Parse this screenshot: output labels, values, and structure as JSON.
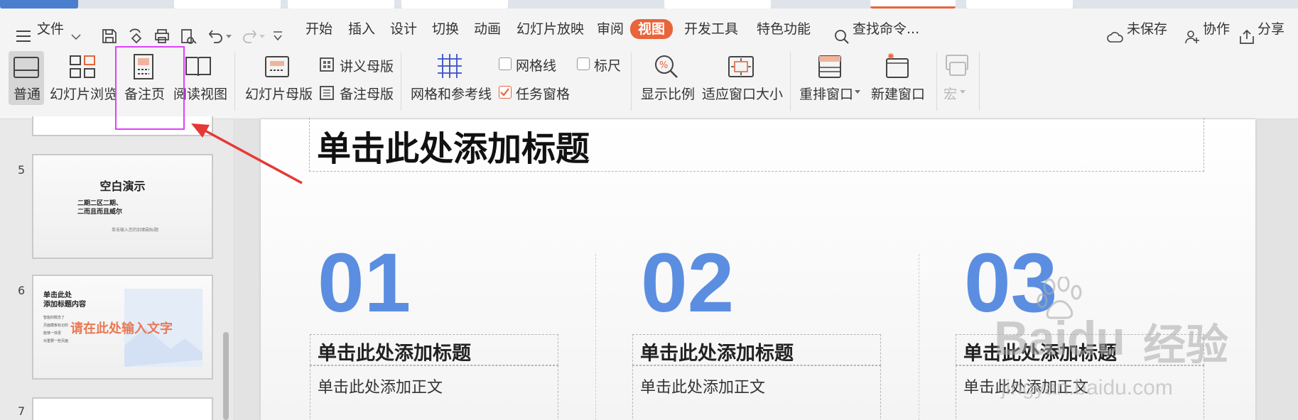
{
  "menu": {
    "file_label": "文件",
    "tabs": [
      "开始",
      "插入",
      "设计",
      "切换",
      "动画",
      "幻灯片放映",
      "审阅",
      "视图",
      "开发工具",
      "特色功能"
    ],
    "search_label": "查找命令...",
    "unsaved_label": "未保存",
    "collab_label": "协作",
    "share_label": "分享"
  },
  "ribbon": {
    "normal": "普通",
    "slide_browse": "幻灯片浏览",
    "notes_page": "备注页",
    "reading_view": "阅读视图",
    "slide_master": "幻灯片母版",
    "handout_master": "讲义母版",
    "notes_master": "备注母版",
    "grid_guides": "网格和参考线",
    "gridlines": "网格线",
    "ruler": "标尺",
    "task_pane": "任务窗格",
    "zoom": "显示比例",
    "fit_window": "适应窗口大小",
    "arrange_windows": "重排窗口",
    "new_window": "新建窗口",
    "macro": "宏",
    "gridlines_checked": false,
    "ruler_checked": false,
    "task_pane_checked": true
  },
  "thumbnails": {
    "slide5": {
      "number": "5",
      "title": "空白演示",
      "line1": "二期二区二期、",
      "line2": "二而且而且威尔",
      "caption": "单击输入您的封面副标题"
    },
    "slide6": {
      "number": "6",
      "title_line1": "单击此处",
      "title_line2": "添加标题内容",
      "bullets": [
        "智能的概念了",
        "页面模板标记的",
        "能够一体更",
        "对重要一些页面"
      ],
      "overlay": "请在此处输入文字"
    },
    "slide7": {
      "number": "7"
    }
  },
  "slide": {
    "title": "单击此处添加标题",
    "columns": [
      {
        "number": "01",
        "heading": "单击此处添加标题",
        "body": "单击此处添加正文"
      },
      {
        "number": "02",
        "heading": "单击此处添加标题",
        "body": "单击此处添加正文"
      },
      {
        "number": "03",
        "heading": "单击此处添加标题",
        "body": "单击此处添加正文"
      }
    ]
  },
  "watermark": {
    "brand": "Baidu",
    "cn": "经验",
    "url": "jingyan.baidu.com"
  },
  "colors": {
    "accent": "#e8643a",
    "highlight_box": "#e040fb",
    "arrow": "#e53935",
    "number_blue": "#5b8ee0"
  }
}
